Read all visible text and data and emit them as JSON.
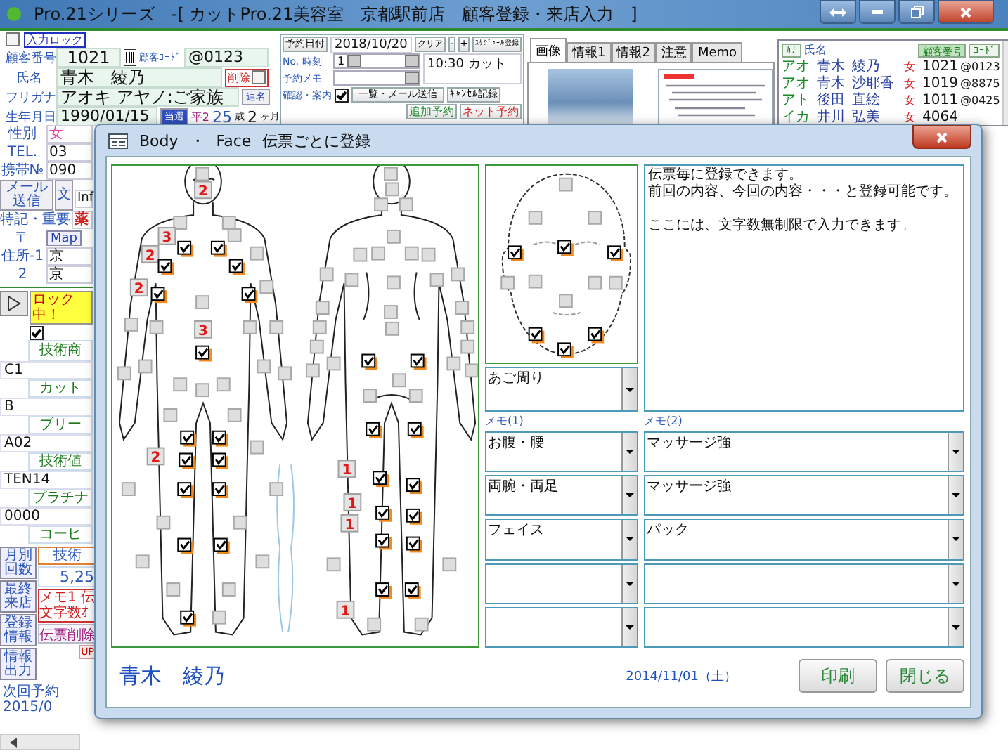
{
  "window": {
    "title": "Pro.21シリーズ　-[ カットPro.21美容室　京都駅前店　顧客登録・来店入力　]"
  },
  "customer": {
    "input_lock": {
      "label": "入力ロック",
      "checked": false
    },
    "number_label": "顧客番号",
    "number": "1021",
    "code_label": "顧客ｺｰﾄﾞ",
    "code": "@0123",
    "name_label": "氏名",
    "name": "青木　綾乃",
    "delete": {
      "label": "削除",
      "checked": false
    },
    "kana_label": "フリガナ",
    "kana": "アオキ アヤノ:ご家族",
    "joint_button": "連名",
    "birth_label": "生年月日",
    "birth": "1990/01/15",
    "birth_button": "当選",
    "era": "平2",
    "age": "25",
    "age_unit": "歳",
    "months": "2",
    "months_unit": "ヶ月",
    "sex_label": "性別",
    "sex": "女",
    "tel_label": "TEL.",
    "tel": "03",
    "mobile_label": "携帯№",
    "mobile": "090",
    "mail_button": "メール送信",
    "text_button": "文",
    "info": "Inf",
    "notes_label": "特記・重要",
    "notes": "薬",
    "zip_label": "〒",
    "map_button": "Map",
    "address1_label": "住所-1",
    "address1": "京",
    "address2_label": "2",
    "address2": "京"
  },
  "visit": {
    "lock": {
      "label": "ロック中！",
      "checked": true
    },
    "header": "技術商",
    "items": [
      {
        "code": "C1",
        "name": "カット"
      },
      {
        "code": "B",
        "name": "ブリー"
      },
      {
        "code": "A02",
        "name": "技術値"
      },
      {
        "code": "TEN14",
        "name": "プラチナ"
      },
      {
        "code": "0000",
        "name": "コーヒ"
      }
    ],
    "side_buttons": [
      "月別回数",
      "最終来店",
      "登録情報",
      "情報出力"
    ],
    "tech_label": "技術",
    "tech_amount": "5,25",
    "memo_lines": [
      "メモ1 伝",
      "文字数ｵ"
    ],
    "slip_delete": "伝票削除",
    "up_button": "UP",
    "next_reservation": "次回予約 2015/0"
  },
  "reservation": {
    "date_button": "予約日付",
    "date": "2018/10/20",
    "clear_button": "クリア",
    "minus_button": "-",
    "plus_button": "+",
    "schedule_button": "ｽｹｼﾞｭｰﾙ登録",
    "no_time_label": "No. 時刻",
    "no": "1",
    "memo_label": "予約メモ",
    "entry": "10:30 カット",
    "confirm_label": "確認・案内",
    "confirm_checked": true,
    "mail_list_button": "一覧・メール送信",
    "cancel_button": "ｷｬﾝｾﾙ記録",
    "add_button": "追加予約",
    "net_button": "ネット予約"
  },
  "info_tabs": [
    {
      "label": "画像",
      "selected": true
    },
    {
      "label": "情報1",
      "selected": false
    },
    {
      "label": "情報2",
      "selected": false
    },
    {
      "label": "注意",
      "selected": false
    },
    {
      "label": "Memo",
      "selected": false
    }
  ],
  "customer_list": {
    "columns": [
      "ｶﾅ",
      "氏名",
      "顧客番号",
      "ｺｰﾄﾞ"
    ],
    "rows": [
      {
        "kana": "アオ",
        "surname": "青木",
        "given": "綾乃",
        "sex": "女",
        "number": "1021",
        "code": "@0123"
      },
      {
        "kana": "アオ",
        "surname": "青木",
        "given": "沙耶香",
        "sex": "女",
        "number": "1019",
        "code": "@8875"
      },
      {
        "kana": "アト",
        "surname": "後田",
        "given": "直絵",
        "sex": "女",
        "number": "1011",
        "code": "@0425"
      },
      {
        "kana": "イカ",
        "surname": "井川",
        "given": "弘美",
        "sex": "女",
        "number": "4064"
      }
    ]
  },
  "dialog": {
    "title_items": [
      "Body",
      "・",
      "Face",
      "伝票ごとに登録"
    ],
    "front_markers": [
      {
        "kind": "check",
        "checked": false
      },
      {
        "kind": "count",
        "label": "2"
      },
      {
        "kind": "check",
        "checked": false
      },
      {
        "kind": "check",
        "checked": false
      },
      {
        "kind": "count",
        "label": "3"
      },
      {
        "kind": "check",
        "checked": false
      },
      {
        "kind": "check",
        "checked": true
      },
      {
        "kind": "check",
        "checked": true
      },
      {
        "kind": "count",
        "label": "2"
      },
      {
        "kind": "check",
        "checked": false
      },
      {
        "kind": "check",
        "checked": true
      },
      {
        "kind": "check",
        "checked": true
      },
      {
        "kind": "count",
        "label": "2"
      },
      {
        "kind": "check",
        "checked": false
      },
      {
        "kind": "check",
        "checked": true
      },
      {
        "kind": "check",
        "checked": true
      },
      {
        "kind": "check",
        "checked": false
      },
      {
        "kind": "check",
        "checked": false
      },
      {
        "kind": "check",
        "checked": false
      },
      {
        "kind": "count",
        "label": "3"
      },
      {
        "kind": "check",
        "checked": false
      },
      {
        "kind": "check",
        "checked": false
      },
      {
        "kind": "check",
        "checked": true
      },
      {
        "kind": "check",
        "checked": false
      },
      {
        "kind": "check",
        "checked": false
      },
      {
        "kind": "check",
        "checked": false
      },
      {
        "kind": "check",
        "checked": false
      },
      {
        "kind": "check",
        "checked": false
      },
      {
        "kind": "check",
        "checked": false
      },
      {
        "kind": "check",
        "checked": false
      },
      {
        "kind": "check",
        "checked": false
      },
      {
        "kind": "check",
        "checked": false
      },
      {
        "kind": "check",
        "checked": true
      },
      {
        "kind": "check",
        "checked": true
      },
      {
        "kind": "count",
        "label": "2"
      },
      {
        "kind": "check",
        "checked": true
      },
      {
        "kind": "check",
        "checked": true
      },
      {
        "kind": "check",
        "checked": false
      },
      {
        "kind": "check",
        "checked": false
      },
      {
        "kind": "check",
        "checked": false
      },
      {
        "kind": "check",
        "checked": true
      },
      {
        "kind": "check",
        "checked": true
      },
      {
        "kind": "check",
        "checked": false
      },
      {
        "kind": "check",
        "checked": false
      },
      {
        "kind": "check",
        "checked": true
      },
      {
        "kind": "check",
        "checked": true
      },
      {
        "kind": "check",
        "checked": false
      },
      {
        "kind": "check",
        "checked": false
      },
      {
        "kind": "check",
        "checked": false
      },
      {
        "kind": "check",
        "checked": false
      },
      {
        "kind": "check",
        "checked": true
      },
      {
        "kind": "check",
        "checked": false
      }
    ],
    "back_markers": [
      {
        "kind": "check",
        "checked": false
      },
      {
        "kind": "check",
        "checked": false
      },
      {
        "kind": "check",
        "checked": false
      },
      {
        "kind": "check",
        "checked": false
      },
      {
        "kind": "check",
        "checked": false
      },
      {
        "kind": "check",
        "checked": false
      },
      {
        "kind": "check",
        "checked": false
      },
      {
        "kind": "check",
        "checked": false
      },
      {
        "kind": "check",
        "checked": false
      },
      {
        "kind": "check",
        "checked": false
      },
      {
        "kind": "check",
        "checked": false
      },
      {
        "kind": "check",
        "checked": false
      },
      {
        "kind": "check",
        "checked": false
      },
      {
        "kind": "check",
        "checked": false
      },
      {
        "kind": "check",
        "checked": false
      },
      {
        "kind": "check",
        "checked": false
      },
      {
        "kind": "check",
        "checked": false
      },
      {
        "kind": "check",
        "checked": false
      },
      {
        "kind": "check",
        "checked": false
      },
      {
        "kind": "check",
        "checked": false
      },
      {
        "kind": "check",
        "checked": false
      },
      {
        "kind": "check",
        "checked": false
      },
      {
        "kind": "check",
        "checked": true
      },
      {
        "kind": "check",
        "checked": true
      },
      {
        "kind": "check",
        "checked": false
      },
      {
        "kind": "check",
        "checked": false
      },
      {
        "kind": "check",
        "checked": false
      },
      {
        "kind": "check",
        "checked": false
      },
      {
        "kind": "check",
        "checked": false
      },
      {
        "kind": "check",
        "checked": false
      },
      {
        "kind": "check",
        "checked": false
      },
      {
        "kind": "check",
        "checked": true
      },
      {
        "kind": "check",
        "checked": true
      },
      {
        "kind": "count",
        "label": "1"
      },
      {
        "kind": "check",
        "checked": true
      },
      {
        "kind": "check",
        "checked": true
      },
      {
        "kind": "count",
        "label": "1"
      },
      {
        "kind": "check",
        "checked": true
      },
      {
        "kind": "check",
        "checked": true
      },
      {
        "kind": "count",
        "label": "1"
      },
      {
        "kind": "check",
        "checked": true
      },
      {
        "kind": "check",
        "checked": true
      },
      {
        "kind": "check",
        "checked": false
      },
      {
        "kind": "check",
        "checked": false
      },
      {
        "kind": "count",
        "label": "1"
      },
      {
        "kind": "check",
        "checked": true
      },
      {
        "kind": "check",
        "checked": true
      },
      {
        "kind": "check",
        "checked": false
      },
      {
        "kind": "check",
        "checked": false
      }
    ],
    "face_markers": [
      {
        "kind": "check",
        "checked": false
      },
      {
        "kind": "check",
        "checked": false
      },
      {
        "kind": "check",
        "checked": false
      },
      {
        "kind": "check",
        "checked": true
      },
      {
        "kind": "check",
        "checked": true
      },
      {
        "kind": "check",
        "checked": true
      },
      {
        "kind": "check",
        "checked": false
      },
      {
        "kind": "check",
        "checked": false
      },
      {
        "kind": "check",
        "checked": false
      },
      {
        "kind": "check",
        "checked": false
      },
      {
        "kind": "check",
        "checked": false
      },
      {
        "kind": "check",
        "checked": true
      },
      {
        "kind": "check",
        "checked": true
      },
      {
        "kind": "check",
        "checked": true
      }
    ],
    "notes_paragraphs": [
      [
        "伝票毎に登録できます。",
        "前回の内容、今回の内容・・・と登録可能です。"
      ],
      [
        "ここには、文字数無制限で入力できます。"
      ]
    ],
    "area": "あご周り",
    "memo1_label": "メモ(1)",
    "memo2_label": "メモ(2)",
    "memo_rows": [
      {
        "memo1": "お腹・腰",
        "memo2": "マッサージ強"
      },
      {
        "memo1": "両腕・両足",
        "memo2": "マッサージ強"
      },
      {
        "memo1": "フェイス",
        "memo2": "パック"
      },
      {},
      {}
    ],
    "customer_name": "青木　綾乃",
    "date": "2014/11/01（土）",
    "print_button": "印刷",
    "close_button": "閉じる"
  }
}
